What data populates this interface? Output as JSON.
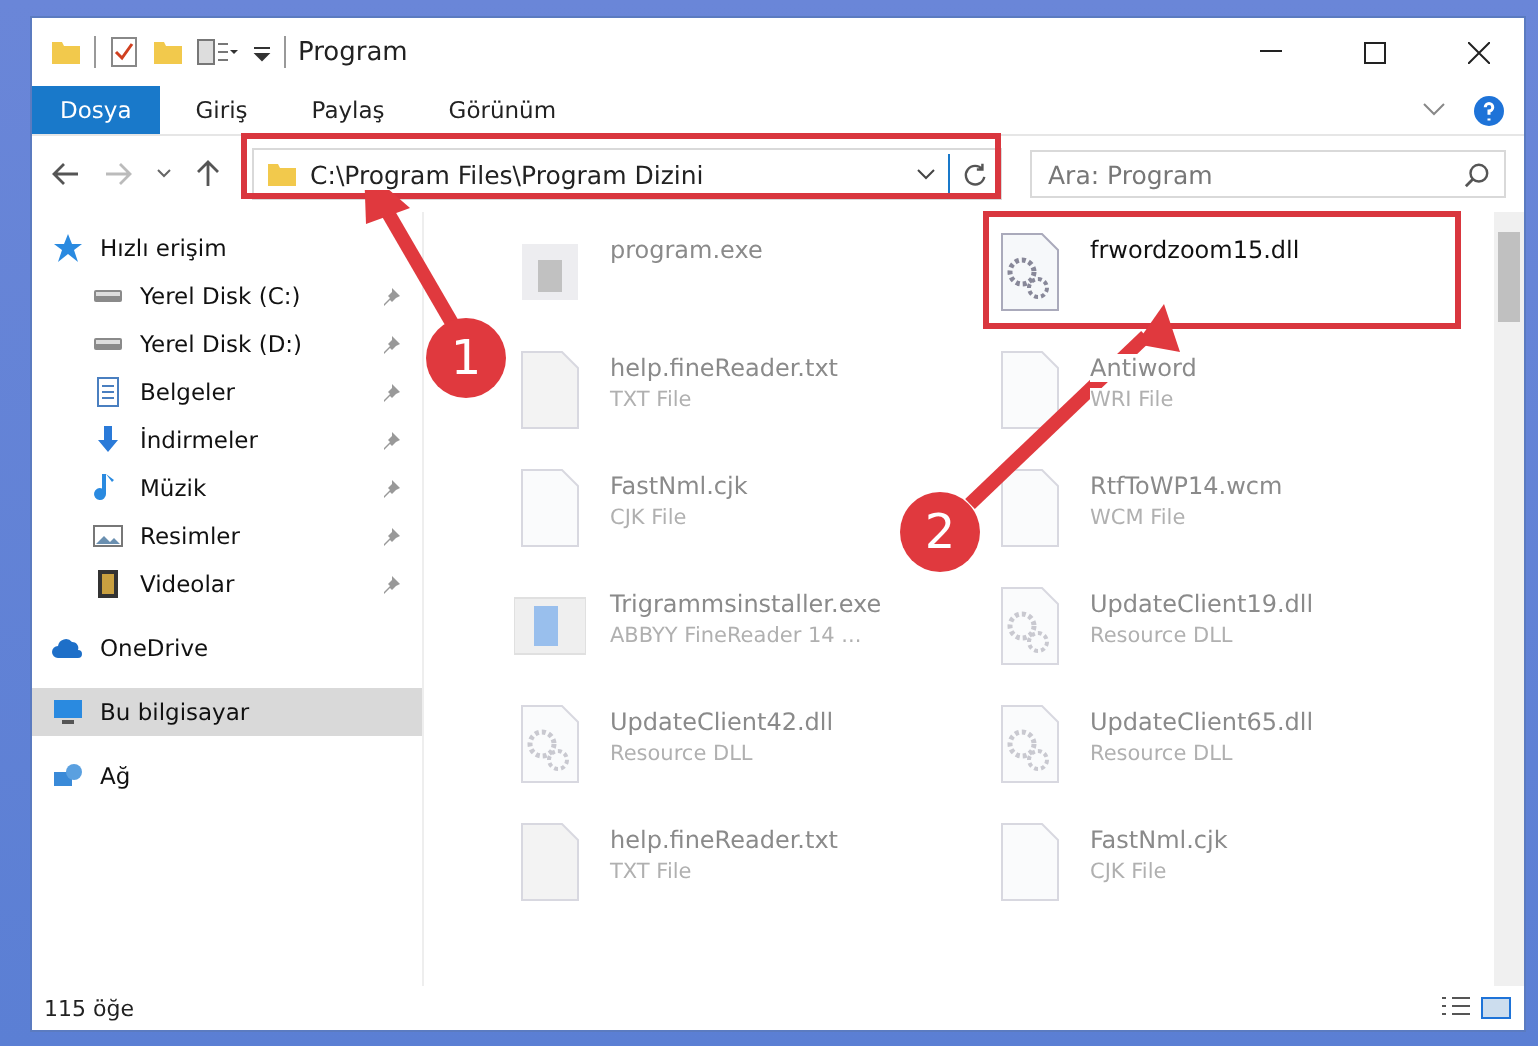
{
  "window": {
    "title": "Program"
  },
  "ribbon_tabs": [
    {
      "label": "Dosya",
      "selected": true
    },
    {
      "label": "Giriş",
      "selected": false
    },
    {
      "label": "Paylaş",
      "selected": false
    },
    {
      "label": "Görünüm",
      "selected": false
    }
  ],
  "address": {
    "path": "C:\\Program Files\\Program Dizini"
  },
  "search": {
    "placeholder": "Ara: Program"
  },
  "sidebar": {
    "items": [
      {
        "label": "Hızlı erişim",
        "kind": "star",
        "selected": false,
        "children": [
          {
            "label": "Yerel Disk (C:)",
            "kind": "drive",
            "pinned": true,
            "selected": false
          },
          {
            "label": "Yerel Disk (D:)",
            "kind": "drive",
            "pinned": true,
            "selected": false
          },
          {
            "label": "Belgeler",
            "kind": "document",
            "pinned": true,
            "selected": false
          },
          {
            "label": "İndirmeler",
            "kind": "download",
            "pinned": true,
            "selected": false
          },
          {
            "label": "Müzik",
            "kind": "music",
            "pinned": true,
            "selected": false
          },
          {
            "label": "Resimler",
            "kind": "image",
            "pinned": true,
            "selected": false
          },
          {
            "label": "Videolar",
            "kind": "video",
            "pinned": true,
            "selected": false
          }
        ]
      },
      {
        "label": "OneDrive",
        "kind": "cloud",
        "selected": false
      },
      {
        "label": "Bu bilgisayar",
        "kind": "computer",
        "selected": true
      },
      {
        "label": "Ağ",
        "kind": "network",
        "selected": false
      }
    ]
  },
  "files": [
    {
      "name": "program.exe",
      "kind": "app",
      "blurred": true
    },
    {
      "name": "frwordzoom15.dll",
      "kind": "gear",
      "blurred": false
    },
    {
      "name": "help.fineReader.txt",
      "type": "TXT File",
      "kind": "text",
      "blurred": true
    },
    {
      "name": "Antiword",
      "type": "WRI File",
      "kind": "blank",
      "blurred": true
    },
    {
      "name": "FastNml.cjk",
      "type": "CJK File",
      "kind": "blank",
      "blurred": true
    },
    {
      "name": "RtfToWP14.wcm",
      "type": "WCM File",
      "kind": "blank",
      "blurred": true
    },
    {
      "name": "Trigrammsinstaller.exe",
      "type": "ABBYY FineReader 14 ...",
      "kind": "installer",
      "blurred": true
    },
    {
      "name": "UpdateClient19.dll",
      "type": "Resource DLL",
      "kind": "gear",
      "blurred": true
    },
    {
      "name": "UpdateClient42.dll",
      "type": "Resource DLL",
      "kind": "gear",
      "blurred": true
    },
    {
      "name": "UpdateClient65.dll",
      "type": "Resource DLL",
      "kind": "gear",
      "blurred": true
    },
    {
      "name": "help.fineReader.txt",
      "type": "TXT File",
      "kind": "text",
      "blurred": true
    },
    {
      "name": "FastNml.cjk",
      "type": "CJK File",
      "kind": "blank",
      "blurred": true
    }
  ],
  "status_bar": {
    "count": "115 öğe"
  },
  "annotations": [
    {
      "number": "1"
    },
    {
      "number": "2"
    }
  ]
}
